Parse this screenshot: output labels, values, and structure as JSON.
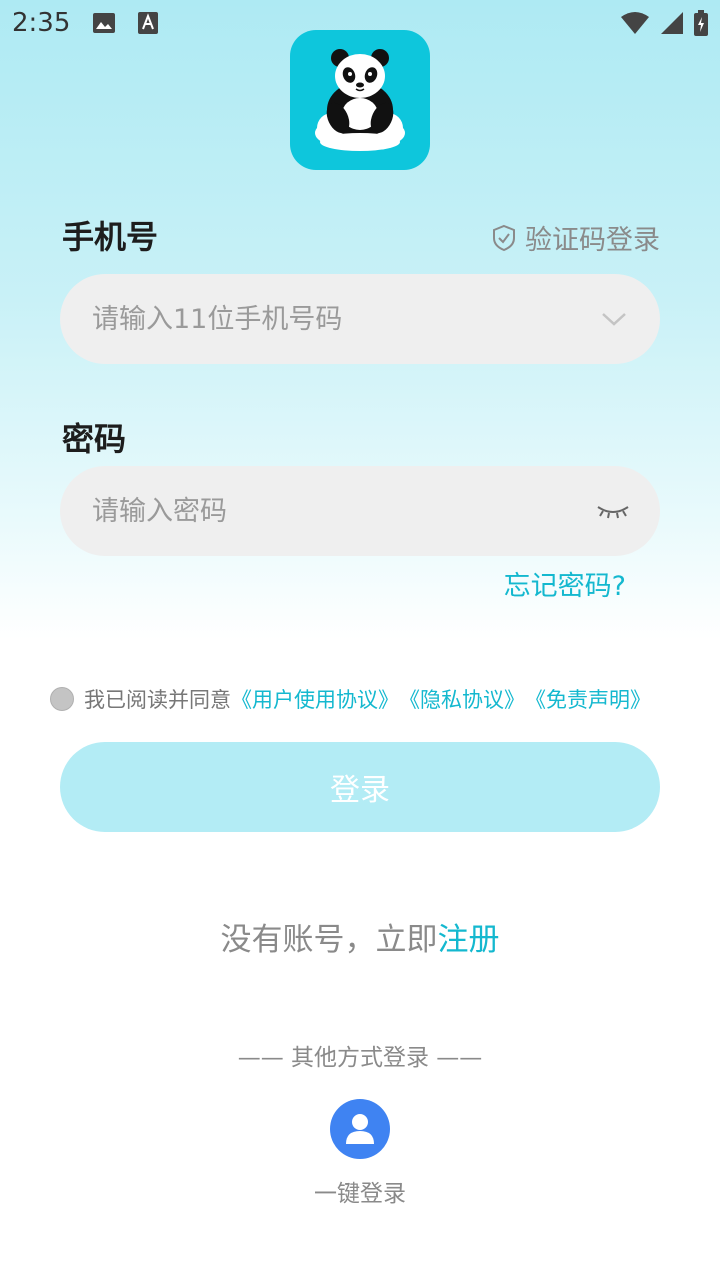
{
  "status_bar": {
    "time": "2:35"
  },
  "form": {
    "phone_label": "手机号",
    "code_login": "验证码登录",
    "phone_placeholder": "请输入11位手机号码",
    "password_label": "密码",
    "password_placeholder": "请输入密码",
    "forgot": "忘记密码?"
  },
  "agreement": {
    "prefix": "我已阅读并同意",
    "user_agreement": "《用户使用协议》",
    "privacy": "《隐私协议》",
    "disclaimer": "《免责声明》"
  },
  "login_button": "登录",
  "register": {
    "prefix": "没有账号，立即",
    "link": "注册"
  },
  "other_methods": "—— 其他方式登录 ——",
  "one_key": {
    "label": "一键登录"
  },
  "colors": {
    "accent": "#14b8cf",
    "button": "#b3ecf5",
    "field": "#efefef",
    "logo_bg": "#0ec6dc",
    "one_key": "#3f83f2"
  },
  "icons": [
    "image-icon",
    "a-font-icon",
    "wifi-icon",
    "signal-icon",
    "battery-icon",
    "panda-logo",
    "shield-check-icon",
    "chevron-down-icon",
    "eye-closed-icon",
    "user-icon"
  ]
}
